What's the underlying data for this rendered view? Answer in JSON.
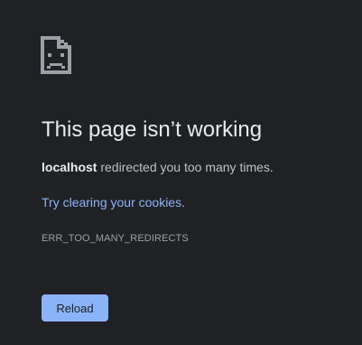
{
  "icon": "sad-page-icon",
  "title": "This page isn’t working",
  "description": {
    "host": "localhost",
    "text": " redirected you too many times."
  },
  "suggestion": {
    "link": "Try clearing your cookies",
    "suffix": "."
  },
  "error_code": "ERR_TOO_MANY_REDIRECTS",
  "reload_label": "Reload",
  "colors": {
    "background": "#202124",
    "link": "#8ab4f8",
    "button": "#8ab4f8"
  }
}
